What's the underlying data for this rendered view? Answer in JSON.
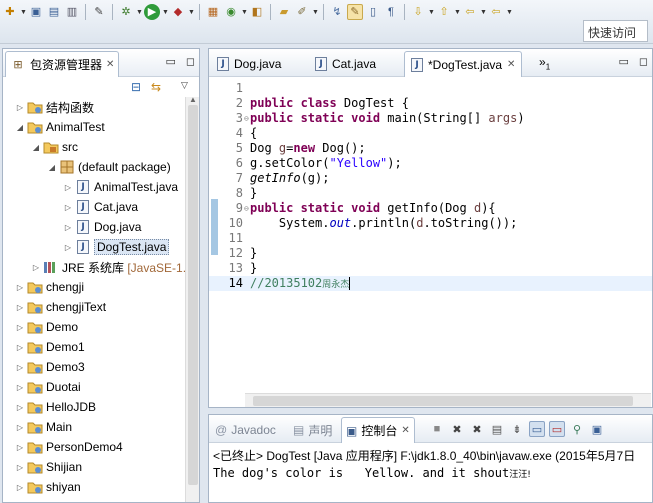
{
  "toolbar": {
    "quick_access": "快速访问",
    "icons": [
      "new-icon",
      "save-icon",
      "save-all-icon",
      "print-icon",
      "debug-icon",
      "run-icon",
      "run-last-icon",
      "external-tools-icon",
      "new-java-project-icon",
      "new-package-icon",
      "new-class-icon",
      "open-type-icon",
      "search-icon",
      "next-annotation-icon",
      "last-edit-icon",
      "back-icon",
      "forward-icon"
    ]
  },
  "explorer": {
    "title": "包资源管理器",
    "tree": [
      {
        "label": "结构函数",
        "icon": "project-icon"
      },
      {
        "label": "AnimalTest",
        "icon": "project-icon"
      },
      {
        "label": "src",
        "icon": "source-folder-icon"
      },
      {
        "label": "(default package)",
        "icon": "package-icon"
      },
      {
        "label": "AnimalTest.java",
        "icon": "java-file-icon"
      },
      {
        "label": "Cat.java",
        "icon": "java-file-icon"
      },
      {
        "label": "Dog.java",
        "icon": "java-file-icon"
      },
      {
        "label": "DogTest.java",
        "icon": "java-file-icon"
      },
      {
        "label": "JRE 系统库 ",
        "extra": "[JavaSE-1.8]",
        "icon": "library-icon"
      },
      {
        "label": "chengji",
        "icon": "project-icon"
      },
      {
        "label": "chengjiText",
        "icon": "project-icon"
      },
      {
        "label": "Demo",
        "icon": "project-icon"
      },
      {
        "label": "Demo1",
        "icon": "project-icon"
      },
      {
        "label": "Demo3",
        "icon": "project-icon"
      },
      {
        "label": "Duotai",
        "icon": "project-icon"
      },
      {
        "label": "HelloJDB",
        "icon": "project-icon"
      },
      {
        "label": "Main",
        "icon": "project-icon"
      },
      {
        "label": "PersonDemo4",
        "icon": "project-icon"
      },
      {
        "label": "Shijian",
        "icon": "project-icon"
      },
      {
        "label": "shiyan",
        "icon": "project-icon"
      }
    ]
  },
  "editor": {
    "tabs": [
      "Dog.java",
      "Cat.java",
      "*DogTest.java"
    ],
    "overflow": "»",
    "overflow_count": "1",
    "lines": {
      "n1": "1",
      "n2": "2",
      "n3": "3",
      "n4": "4",
      "n5": "5",
      "n6": "6",
      "n7": "7",
      "n8": "8",
      "n9": "9",
      "n10": "10",
      "n11": "11",
      "n12": "12",
      "n13": "13",
      "n14": "14",
      "l2_kw": "public class",
      "l2_rest": " DogTest {",
      "l3_kw": "public static void",
      "l3_rest": " main(String[] ",
      "l3_par": "args",
      "l3_end": ")",
      "l4": "{",
      "l5_a": "Dog ",
      "l5_var": "g",
      "l5_eq": "=",
      "l5_kw": "new",
      "l5_rest": " Dog();",
      "l6_a": "g.setColor(",
      "l6_str": "\"Yellow\"",
      "l6_b": ");",
      "l7_it": "getInfo",
      "l7_rest": "(g);",
      "l8": "}",
      "l9_kw": "public static void",
      "l9_rest": " getInfo(Dog ",
      "l9_par": "d",
      "l9_end": "){",
      "l10_a": "    System.",
      "l10_fld": "out",
      "l10_b": ".println(",
      "l10_par": "d",
      "l10_c": ".toString());",
      "l12": "}",
      "l13": "}",
      "l14_cmt": "//20135102",
      "l14_name": "周永杰"
    }
  },
  "console": {
    "tabs": [
      "Javadoc",
      "声明",
      "控制台"
    ],
    "status": "<已终止> DogTest [Java 应用程序] F:\\jdk1.8.0_40\\bin\\javaw.exe (2015年5月7日",
    "output": "The dog's color is   Yellow. and it shout",
    "output_tail": "汪汪!"
  }
}
